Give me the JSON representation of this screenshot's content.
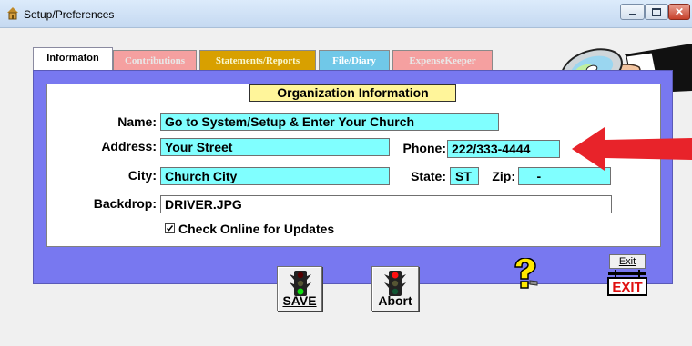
{
  "window": {
    "title": "Setup/Preferences"
  },
  "tabs": [
    {
      "label": "Informaton"
    },
    {
      "label": "Contributions"
    },
    {
      "label": "Statements/Reports"
    },
    {
      "label": "File/Diary"
    },
    {
      "label": "ExpenseKeeper"
    }
  ],
  "section": {
    "title": "Organization Information"
  },
  "form": {
    "name_label": "Name:",
    "name_value": "Go to System/Setup & Enter Your Church",
    "address_label": "Address:",
    "address_value": "Your Street",
    "phone_label": "Phone:",
    "phone_value": "222/333-4444",
    "city_label": "City:",
    "city_value": "Church City",
    "state_label": "State:",
    "state_value": "ST",
    "zip_label": "Zip:",
    "zip_value": "    -",
    "backdrop_label": "Backdrop:",
    "backdrop_value": "DRIVER.JPG",
    "updates_label": "Check Online for Updates",
    "updates_checked": true
  },
  "buttons": {
    "save_label": "SAVE",
    "abort_label": "Abort",
    "exit_label": "Exit",
    "exit_sign_text": "EXIT"
  },
  "colors": {
    "panel": "#7878f0",
    "field": "#80ffff",
    "section_title_bg": "#fff59a",
    "arrow": "#e8232a"
  }
}
